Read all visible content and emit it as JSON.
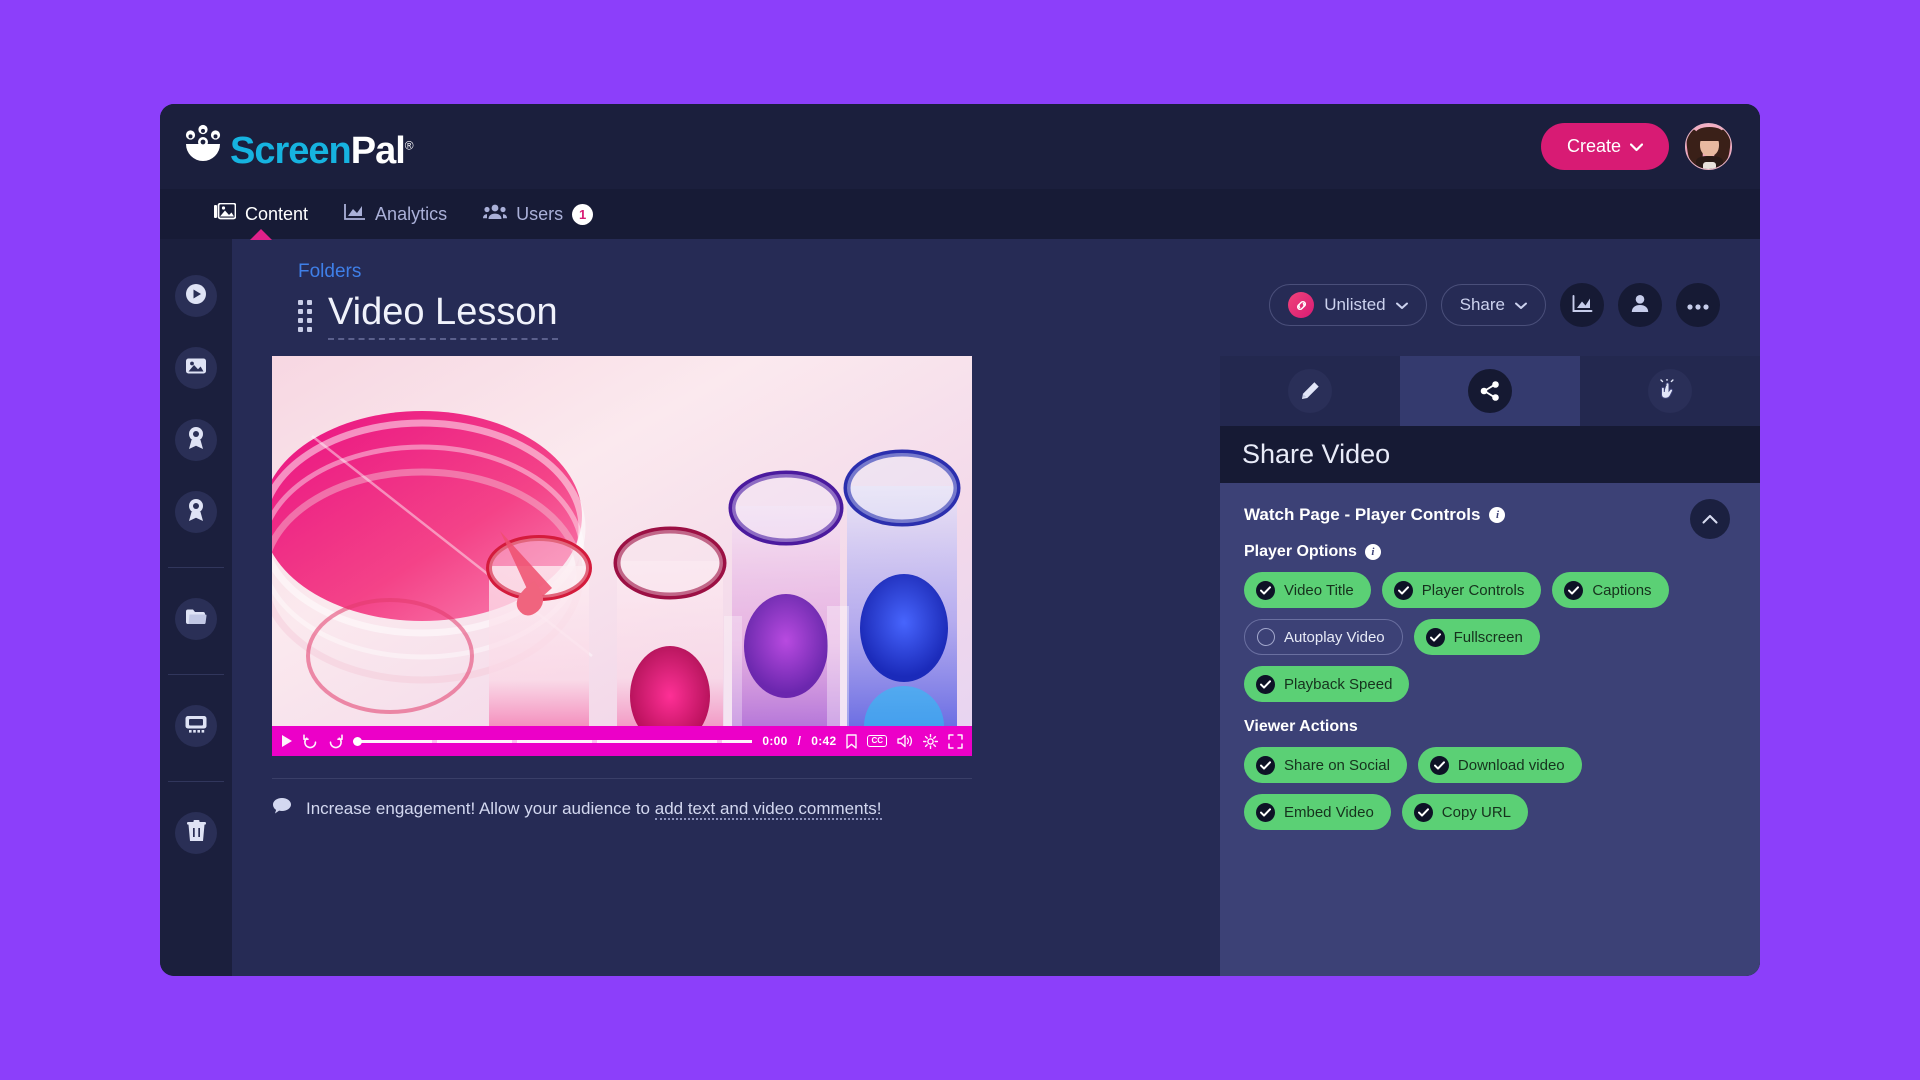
{
  "brand": {
    "name_part1": "Screen",
    "name_part2": "Pal",
    "registered": "®"
  },
  "topbar": {
    "create_label": "Create",
    "create_caret": "⌄",
    "avatar_name": "user-avatar"
  },
  "nav": {
    "items": [
      {
        "label": "Content",
        "icon": "content-images-icon",
        "active": true
      },
      {
        "label": "Analytics",
        "icon": "analytics-chart-icon",
        "active": false
      },
      {
        "label": "Users",
        "icon": "users-group-icon",
        "active": false,
        "badge": "1"
      }
    ]
  },
  "sidebar": {
    "items": [
      {
        "name": "videos",
        "icon": "play-circle-icon"
      },
      {
        "name": "images",
        "icon": "image-icon"
      },
      {
        "name": "badges",
        "icon": "award-ribbon-icon"
      },
      {
        "name": "certificates",
        "icon": "award-ribbon-icon"
      },
      {
        "name": "folders",
        "icon": "folder-icon"
      },
      {
        "name": "courses",
        "icon": "presentation-board-icon"
      },
      {
        "name": "trash",
        "icon": "trash-icon"
      }
    ]
  },
  "page": {
    "breadcrumb": "Folders",
    "title": "Video Lesson",
    "actions": {
      "visibility_label": "Unlisted",
      "visibility_caret": "⌄",
      "share_label": "Share",
      "share_caret": "⌄",
      "stats_icon": "chart-icon",
      "people_icon": "person-icon",
      "more_icon": "more-ellipsis-icon"
    }
  },
  "player": {
    "current_time": "0:00",
    "separator": "/",
    "duration": "0:42",
    "cc_label": "CC",
    "controls": [
      "play-icon",
      "rewind-icon",
      "forward-icon",
      "bookmark-icon",
      "cc-icon",
      "volume-icon",
      "settings-gear-icon",
      "fullscreen-icon"
    ],
    "thumbnail_alt": "laboratory test tubes and petri dish with pink and blue liquid"
  },
  "engagement": {
    "icon": "comment-bubble-icon",
    "text_before": "Increase engagement! Allow your audience to ",
    "link_text": "add text and video comments!"
  },
  "share_panel": {
    "tabs": [
      {
        "name": "edit",
        "icon": "pencil-icon",
        "active": false
      },
      {
        "name": "share",
        "icon": "share-nodes-icon",
        "active": true
      },
      {
        "name": "interact",
        "icon": "click-hand-icon",
        "active": false
      }
    ],
    "title": "Share Video",
    "section": {
      "heading": "Watch Page - Player Controls",
      "collapse_icon": "chevron-up-icon"
    },
    "groups": [
      {
        "label": "Player Options",
        "has_info": true,
        "options": [
          {
            "label": "Video Title",
            "checked": true
          },
          {
            "label": "Player Controls",
            "checked": true
          },
          {
            "label": "Captions",
            "checked": true
          },
          {
            "label": "Autoplay Video",
            "checked": false
          },
          {
            "label": "Fullscreen",
            "checked": true
          },
          {
            "label": "Playback Speed",
            "checked": true
          }
        ],
        "rows": [
          3,
          2,
          1
        ]
      },
      {
        "label": "Viewer Actions",
        "has_info": false,
        "options": [
          {
            "label": "Share on Social",
            "checked": true
          },
          {
            "label": "Download video",
            "checked": true
          },
          {
            "label": "Embed Video",
            "checked": true
          },
          {
            "label": "Copy URL",
            "checked": true
          }
        ],
        "rows": [
          2,
          2
        ]
      }
    ]
  },
  "colors": {
    "page_background": "#8C3FFA",
    "app_background": "#262b55",
    "brand_cyan": "#16B3E0",
    "accent_pink": "#D81B74",
    "player_bar": "#EC00C8",
    "chip_on": "#5BD075",
    "panel_body": "#3c4176",
    "link_blue": "#3f7fe8"
  }
}
